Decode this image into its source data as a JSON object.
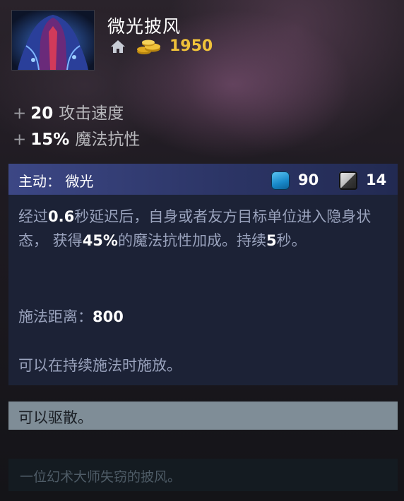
{
  "item": {
    "name": "微光披风",
    "cost": "1950",
    "image_icon": "glimmer-cape-image",
    "shop_icon": "home-icon",
    "gold_icon": "gold-coins-icon"
  },
  "attributes": [
    {
      "plus": "+",
      "value": "20",
      "label": "攻击速度"
    },
    {
      "plus": "+",
      "value": "15%",
      "label": "魔法抗性"
    }
  ],
  "ability": {
    "title": "主动： 微光",
    "mana_cost": "90",
    "cooldown": "14",
    "desc": {
      "p1": "经过",
      "delay": "0.6",
      "p2": "秒延迟后，自身或者友方目标单位进入隐身状态， 获得",
      "resist": "45%",
      "p3": "的魔法抗性加成。持续",
      "duration": "5",
      "p4": "秒。"
    },
    "cast_range_label": "施法距离：",
    "cast_range_value": "800",
    "channel_note": "可以在持续施法时施放。"
  },
  "dispel_text": "可以驱散。",
  "lore": "一位幻术大师失窃的披风。",
  "colors": {
    "cost_gold": "#f0c23a",
    "ability_header": "#3c4785",
    "ability_body": "#1c2236",
    "dispel_bar": "#7f8d97",
    "mana_blue": "#1788c8"
  }
}
